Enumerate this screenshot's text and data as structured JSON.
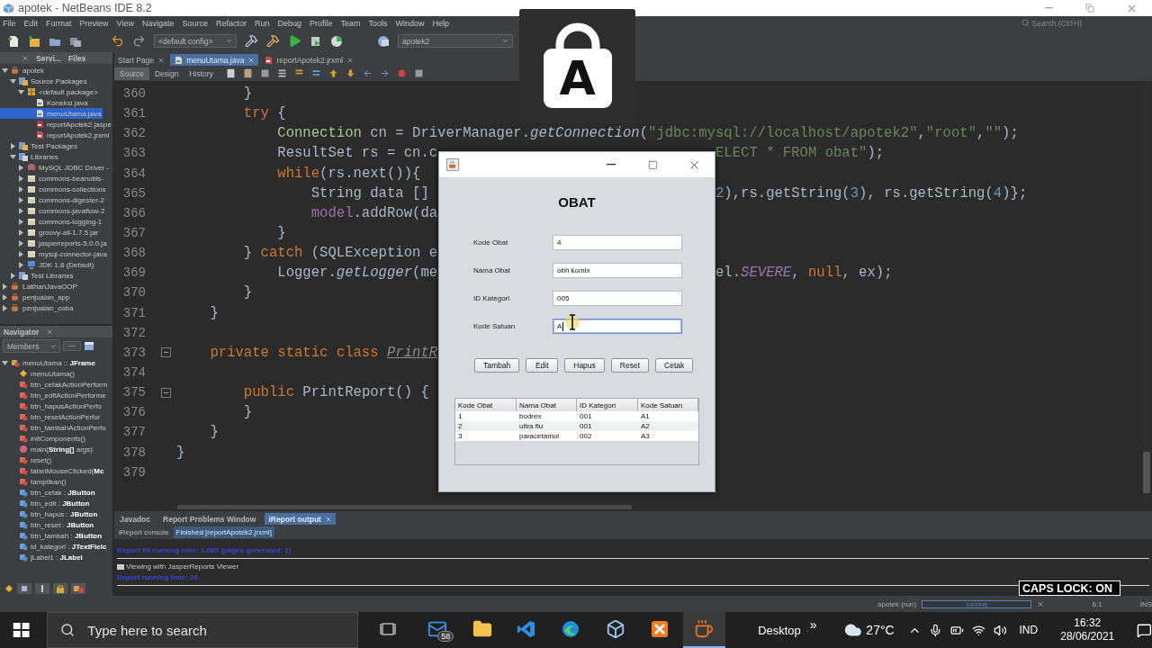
{
  "window": {
    "title": "apotek - NetBeans IDE 8.2"
  },
  "menu": [
    "File",
    "Edit",
    "Format",
    "Preview",
    "View",
    "Navigate",
    "Source",
    "Refactor",
    "Run",
    "Debug",
    "Profile",
    "Team",
    "Tools",
    "Window",
    "Help"
  ],
  "search": {
    "placeholder": "Search (Ctrl+I)"
  },
  "toolbar": {
    "config": "<default config>",
    "project": "apotek2"
  },
  "caps_indicator": {
    "letter": "A"
  },
  "projects": {
    "tabs": [
      {
        "label": "Servi...",
        "selected": false
      },
      {
        "label": "Files",
        "selected": false
      }
    ],
    "tree": [
      {
        "label": "apotek",
        "kind": "project",
        "expanded": true,
        "selected": false,
        "children": [
          {
            "label": "Source Packages",
            "kind": "srcpkg",
            "expanded": true,
            "selected": false,
            "children": [
              {
                "label": "<default package>",
                "kind": "package",
                "expanded": true,
                "selected": false,
                "children": [
                  {
                    "label": "Koneksi.java",
                    "kind": "java",
                    "selected": false
                  },
                  {
                    "label": "menuUtama.java",
                    "kind": "java",
                    "selected": true
                  },
                  {
                    "label": "reportApotek2.jaspe",
                    "kind": "jasper",
                    "selected": false
                  },
                  {
                    "label": "reportApotek2.jrxml",
                    "kind": "jrxml",
                    "selected": false
                  }
                ]
              }
            ]
          },
          {
            "label": "Test Packages",
            "kind": "srcpkg",
            "expanded": false,
            "selected": false
          },
          {
            "label": "Libraries",
            "kind": "lib",
            "expanded": true,
            "selected": false,
            "children": [
              {
                "label": "MySQL JDBC Driver -",
                "kind": "db",
                "expanded": false,
                "selected": false
              },
              {
                "label": "commons-beanutils-",
                "kind": "jar",
                "expanded": false,
                "selected": false
              },
              {
                "label": "commons-collections",
                "kind": "jar",
                "expanded": false,
                "selected": false
              },
              {
                "label": "commons-digester-2",
                "kind": "jar",
                "expanded": false,
                "selected": false
              },
              {
                "label": "commons-javaflow-2",
                "kind": "jar",
                "expanded": false,
                "selected": false
              },
              {
                "label": "commons-logging-1",
                "kind": "jar",
                "expanded": false,
                "selected": false
              },
              {
                "label": "groovy-all-1.7.5.jar",
                "kind": "jar",
                "expanded": false,
                "selected": false
              },
              {
                "label": "jasperreports-5.0.0.ja",
                "kind": "jar",
                "expanded": false,
                "selected": false
              },
              {
                "label": "mysql-connector-java",
                "kind": "jar",
                "expanded": false,
                "selected": false
              },
              {
                "label": "JDK 1.8 (Default)",
                "kind": "jdk",
                "expanded": false,
                "selected": false
              }
            ]
          },
          {
            "label": "Test Libraries",
            "kind": "lib",
            "expanded": false,
            "selected": false
          }
        ]
      },
      {
        "label": "LatihanJavaOOP",
        "kind": "project",
        "expanded": false,
        "selected": false
      },
      {
        "label": "penjualan_app",
        "kind": "project",
        "expanded": false,
        "selected": false
      },
      {
        "label": "penjualan_coba",
        "kind": "project",
        "expanded": false,
        "selected": false
      }
    ]
  },
  "navigator": {
    "title": "Navigator",
    "filter": "Members",
    "tree": [
      {
        "label": "menuUtama :: **JFrame**",
        "kind": "class",
        "expanded": true,
        "children": [
          {
            "label": "menuUtama()",
            "kind": "constructor"
          },
          {
            "label": "btn_cetakActionPerform",
            "kind": "method"
          },
          {
            "label": "btn_editActionPerforme",
            "kind": "method"
          },
          {
            "label": "btn_hapusActionPerfo",
            "kind": "method"
          },
          {
            "label": "btn_resetActionPerfor",
            "kind": "method"
          },
          {
            "label": "btn_tambahActionPerfo",
            "kind": "method"
          },
          {
            "label": "initComponents()",
            "kind": "method"
          },
          {
            "label": "main(**String[]** args)",
            "kind": "static"
          },
          {
            "label": "reset()",
            "kind": "method"
          },
          {
            "label": "tabelMouseClicked(**Mc**",
            "kind": "method"
          },
          {
            "label": "tampilkan()",
            "kind": "method"
          },
          {
            "label": "btn_cetak : **JButton**",
            "kind": "field"
          },
          {
            "label": "btn_edit : **JButton**",
            "kind": "field"
          },
          {
            "label": "btn_hapus : **JButton**",
            "kind": "field"
          },
          {
            "label": "btn_reset : **JButton**",
            "kind": "field"
          },
          {
            "label": "btn_tambah : **JButton**",
            "kind": "field"
          },
          {
            "label": "id_kategori : **JTextFielc**",
            "kind": "field"
          },
          {
            "label": "jLabel1 : **JLabel**",
            "kind": "field"
          }
        ]
      }
    ]
  },
  "editor": {
    "tabs": [
      {
        "label": "Start Page",
        "selected": false
      },
      {
        "label": "menuUtama.java",
        "selected": true
      },
      {
        "label": "reportApotek2.jrxml",
        "selected": false
      }
    ],
    "views": [
      {
        "label": "Source",
        "selected": true
      },
      {
        "label": "Design",
        "selected": false
      },
      {
        "label": "History",
        "selected": false
      }
    ],
    "lines": [
      {
        "number": "360",
        "left": [
          {
            "kind": "plain",
            "text": "        }"
          }
        ]
      },
      {
        "number": "361",
        "left": [
          {
            "kind": "kw",
            "text": "        try"
          },
          {
            "kind": "plain",
            "text": " {"
          }
        ]
      },
      {
        "number": "362",
        "left": [
          {
            "kind": "type",
            "text": "            Connection"
          },
          {
            "kind": "plain",
            "text": " cn = DriverManager."
          },
          {
            "kind": "method",
            "text": "getConnection"
          },
          {
            "kind": "plain",
            "text": "("
          },
          {
            "kind": "str",
            "text": "\"jdbc:mysql://localhost/apotek2\""
          },
          {
            "kind": "plain",
            "text": ","
          },
          {
            "kind": "str",
            "text": "\"root\""
          },
          {
            "kind": "plain",
            "text": ","
          },
          {
            "kind": "str",
            "text": "\"\""
          },
          {
            "kind": "plain",
            "text": ");"
          }
        ]
      },
      {
        "number": "363",
        "left": [
          {
            "kind": "plain",
            "text": "            ResultSet rs = cn.c"
          }
        ],
        "right": [
          {
            "kind": "str",
            "text": "ELECT * FROM obat\""
          },
          {
            "kind": "plain",
            "text": ");"
          }
        ]
      },
      {
        "number": "364",
        "left": [
          {
            "kind": "kw",
            "text": "            while"
          },
          {
            "kind": "plain",
            "text": "(rs.next()){"
          }
        ]
      },
      {
        "number": "365",
        "left": [
          {
            "kind": "plain",
            "text": "                String data [] "
          }
        ],
        "right": [
          {
            "kind": "num",
            "text": "2"
          },
          {
            "kind": "plain",
            "text": "),rs.getString("
          },
          {
            "kind": "num",
            "text": "3"
          },
          {
            "kind": "plain",
            "text": "), rs.getString("
          },
          {
            "kind": "num",
            "text": "4"
          },
          {
            "kind": "plain",
            "text": ")};"
          }
        ]
      },
      {
        "number": "366",
        "left": [
          {
            "kind": "field",
            "text": "                model"
          },
          {
            "kind": "plain",
            "text": ".addRow(da"
          }
        ]
      },
      {
        "number": "367",
        "left": [
          {
            "kind": "plain",
            "text": "            }"
          }
        ]
      },
      {
        "number": "368",
        "left": [
          {
            "kind": "plain",
            "text": "        } "
          },
          {
            "kind": "kw",
            "text": "catch"
          },
          {
            "kind": "plain",
            "text": " (SQLException e"
          }
        ]
      },
      {
        "number": "369",
        "left": [
          {
            "kind": "plain",
            "text": "            Logger."
          },
          {
            "kind": "method",
            "text": "getLogger"
          },
          {
            "kind": "plain",
            "text": "(me"
          }
        ],
        "right": [
          {
            "kind": "plain",
            "text": "el."
          },
          {
            "kind": "const",
            "text": "SEVERE"
          },
          {
            "kind": "plain",
            "text": ", "
          },
          {
            "kind": "kw",
            "text": "null"
          },
          {
            "kind": "plain",
            "text": ", ex);"
          }
        ]
      },
      {
        "number": "370",
        "left": [
          {
            "kind": "plain",
            "text": "        }"
          }
        ]
      },
      {
        "number": "371",
        "left": [
          {
            "kind": "plain",
            "text": "    }"
          }
        ]
      },
      {
        "number": "372"
      },
      {
        "number": "373",
        "fold": true,
        "left": [
          {
            "kind": "kw",
            "text": "    private static class "
          },
          {
            "kind": "unused",
            "text": "PrintR"
          }
        ]
      },
      {
        "number": "374"
      },
      {
        "number": "375",
        "fold": true,
        "left": [
          {
            "kind": "kw",
            "text": "        public"
          },
          {
            "kind": "plain",
            "text": " PrintReport() {"
          }
        ]
      },
      {
        "number": "376",
        "left": [
          {
            "kind": "plain",
            "text": "        }"
          }
        ]
      },
      {
        "number": "377",
        "left": [
          {
            "kind": "plain",
            "text": "    }"
          }
        ]
      },
      {
        "number": "378",
        "left": [
          {
            "kind": "plain",
            "text": "}"
          }
        ]
      },
      {
        "number": "379"
      }
    ]
  },
  "dialog": {
    "title": "OBAT",
    "fields": [
      {
        "label": "Kode Obat",
        "value": "4",
        "focused": false
      },
      {
        "label": "Nama Obat",
        "value": "obh komix",
        "focused": false
      },
      {
        "label": "ID Kategori",
        "value": "005",
        "focused": false
      },
      {
        "label": "Kode Satuan",
        "value": "A",
        "focused": true
      }
    ],
    "buttons": [
      "Tambah",
      "Edit",
      "Hapus",
      "Reset",
      "Cetak"
    ],
    "table": {
      "columns": [
        "Kode Obat",
        "Nama Obat",
        "ID Kategori",
        "Kode Satuan"
      ],
      "rows": [
        [
          "1",
          "bodrex",
          "001",
          "A1"
        ],
        [
          "2",
          "ultra flu",
          "001",
          "A2"
        ],
        [
          "3",
          "paracetamol",
          "002",
          "A3"
        ]
      ]
    }
  },
  "output": {
    "tabs": [
      {
        "label": "Javadoc",
        "selected": false
      },
      {
        "label": "Report Problems Window",
        "selected": false
      },
      {
        "label": "iReport output",
        "selected": true
      }
    ],
    "subtabs": [
      {
        "label": "iReport console",
        "selected": false
      },
      {
        "label": "Finished [reportApotek2.jrxml]",
        "selected": true
      }
    ],
    "lines": [
      {
        "kind": "info",
        "text": "Report fill running time: 1,085 (pages generated: 1)"
      },
      {
        "kind": "viewer",
        "text": "Viewing with JasperReports Viewer"
      },
      {
        "kind": "info",
        "text": "Export running time: 24"
      }
    ]
  },
  "caps_notice": {
    "text": "CAPS LOCK: ON"
  },
  "status": {
    "task": "apotek (run)",
    "progress": {
      "label": "running",
      "level": 1
    },
    "position": "6:1",
    "mode": "INS"
  },
  "taskbar": {
    "search": {
      "placeholder": "Type here to search"
    },
    "apps": [
      {
        "kind": "mail",
        "badge": "58",
        "selected": false
      },
      {
        "kind": "explorer",
        "selected": false
      },
      {
        "kind": "vscode",
        "selected": false
      },
      {
        "kind": "edge",
        "selected": false
      },
      {
        "kind": "cube",
        "selected": false
      },
      {
        "kind": "xampp",
        "selected": false
      },
      {
        "kind": "java",
        "selected": true
      }
    ],
    "desktop": "Desktop",
    "overflow": "»",
    "weather": "27°C",
    "language": "IND",
    "time": "16:32",
    "date": "28/06/2021"
  }
}
